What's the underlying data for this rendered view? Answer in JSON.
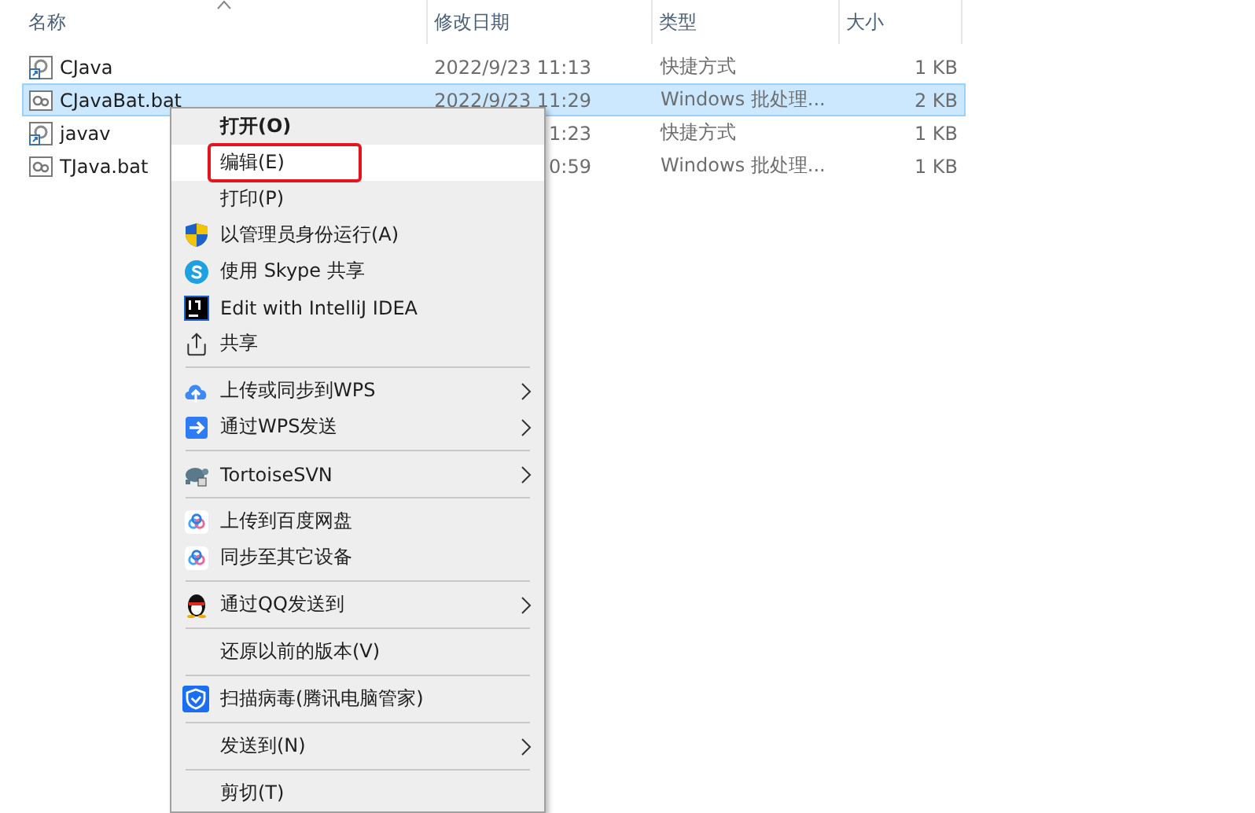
{
  "columns": [
    {
      "label": "名称",
      "sorted": true
    },
    {
      "label": "修改日期",
      "sorted": false
    },
    {
      "label": "类型",
      "sorted": false
    },
    {
      "label": "大小",
      "sorted": false
    }
  ],
  "files": [
    {
      "name": "CJava",
      "date": "2022/9/23 11:13",
      "type": "快捷方式",
      "size": "1 KB",
      "kind": "shortcut",
      "selected": false
    },
    {
      "name": "CJavaBat.bat",
      "date": "2022/9/23 11:29",
      "type": "Windows 批处理...",
      "size": "2 KB",
      "kind": "batch",
      "selected": true
    },
    {
      "name": "javav",
      "date": "1:23",
      "type": "快捷方式",
      "size": "1 KB",
      "kind": "shortcut",
      "selected": false
    },
    {
      "name": "TJava.bat",
      "date": "0:59",
      "type": "Windows 批处理...",
      "size": "1 KB",
      "kind": "batch",
      "selected": false
    }
  ],
  "context_menu": [
    {
      "kind": "item",
      "label": "打开(O)",
      "default": true,
      "hovered": false,
      "marked": false,
      "submenu": false
    },
    {
      "kind": "item",
      "label": "编辑(E)",
      "default": false,
      "hovered": true,
      "marked": true,
      "submenu": false
    },
    {
      "kind": "item",
      "label": "打印(P)",
      "default": false,
      "hovered": false,
      "marked": false,
      "submenu": false
    },
    {
      "kind": "item",
      "label": "以管理员身份运行(A)",
      "default": false,
      "hovered": false,
      "marked": false,
      "submenu": false
    },
    {
      "kind": "item",
      "label": "使用 Skype 共享",
      "default": false,
      "hovered": false,
      "marked": false,
      "submenu": false
    },
    {
      "kind": "item",
      "label": "Edit with IntelliJ IDEA",
      "default": false,
      "hovered": false,
      "marked": false,
      "submenu": false
    },
    {
      "kind": "item",
      "label": "共享",
      "default": false,
      "hovered": false,
      "marked": false,
      "submenu": false
    },
    {
      "kind": "separator"
    },
    {
      "kind": "item",
      "label": "上传或同步到WPS",
      "default": false,
      "hovered": false,
      "marked": false,
      "submenu": true
    },
    {
      "kind": "item",
      "label": "通过WPS发送",
      "default": false,
      "hovered": false,
      "marked": false,
      "submenu": true
    },
    {
      "kind": "separator"
    },
    {
      "kind": "item",
      "label": "TortoiseSVN",
      "default": false,
      "hovered": false,
      "marked": false,
      "submenu": true
    },
    {
      "kind": "separator"
    },
    {
      "kind": "item",
      "label": "上传到百度网盘",
      "default": false,
      "hovered": false,
      "marked": false,
      "submenu": false
    },
    {
      "kind": "item",
      "label": "同步至其它设备",
      "default": false,
      "hovered": false,
      "marked": false,
      "submenu": false
    },
    {
      "kind": "separator"
    },
    {
      "kind": "item",
      "label": "通过QQ发送到",
      "default": false,
      "hovered": false,
      "marked": false,
      "submenu": true
    },
    {
      "kind": "separator"
    },
    {
      "kind": "item",
      "label": "还原以前的版本(V)",
      "default": false,
      "hovered": false,
      "marked": false,
      "submenu": false
    },
    {
      "kind": "separator"
    },
    {
      "kind": "item",
      "label": "扫描病毒(腾讯电脑管家)",
      "default": false,
      "hovered": false,
      "marked": false,
      "submenu": false
    },
    {
      "kind": "separator"
    },
    {
      "kind": "item",
      "label": "发送到(N)",
      "default": false,
      "hovered": false,
      "marked": false,
      "submenu": true
    },
    {
      "kind": "separator"
    },
    {
      "kind": "item",
      "label": "剪切(T)",
      "default": false,
      "hovered": false,
      "marked": false,
      "submenu": false
    }
  ]
}
